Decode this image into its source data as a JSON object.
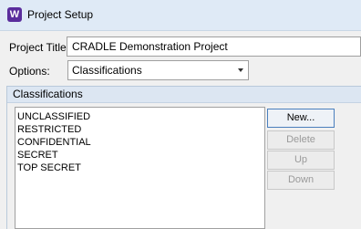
{
  "window": {
    "title": "Project Setup",
    "icon_letter": "W"
  },
  "form": {
    "project_title_label": "Project Title:",
    "project_title_value": "CRADLE Demonstration Project",
    "options_label": "Options:",
    "options_selected": "Classifications"
  },
  "classifications": {
    "group_title": "Classifications",
    "items": [
      "UNCLASSIFIED",
      "RESTRICTED",
      "CONFIDENTIAL",
      "SECRET",
      "TOP SECRET"
    ],
    "buttons": {
      "new": "New...",
      "delete": "Delete",
      "up": "Up",
      "down": "Down"
    }
  }
}
